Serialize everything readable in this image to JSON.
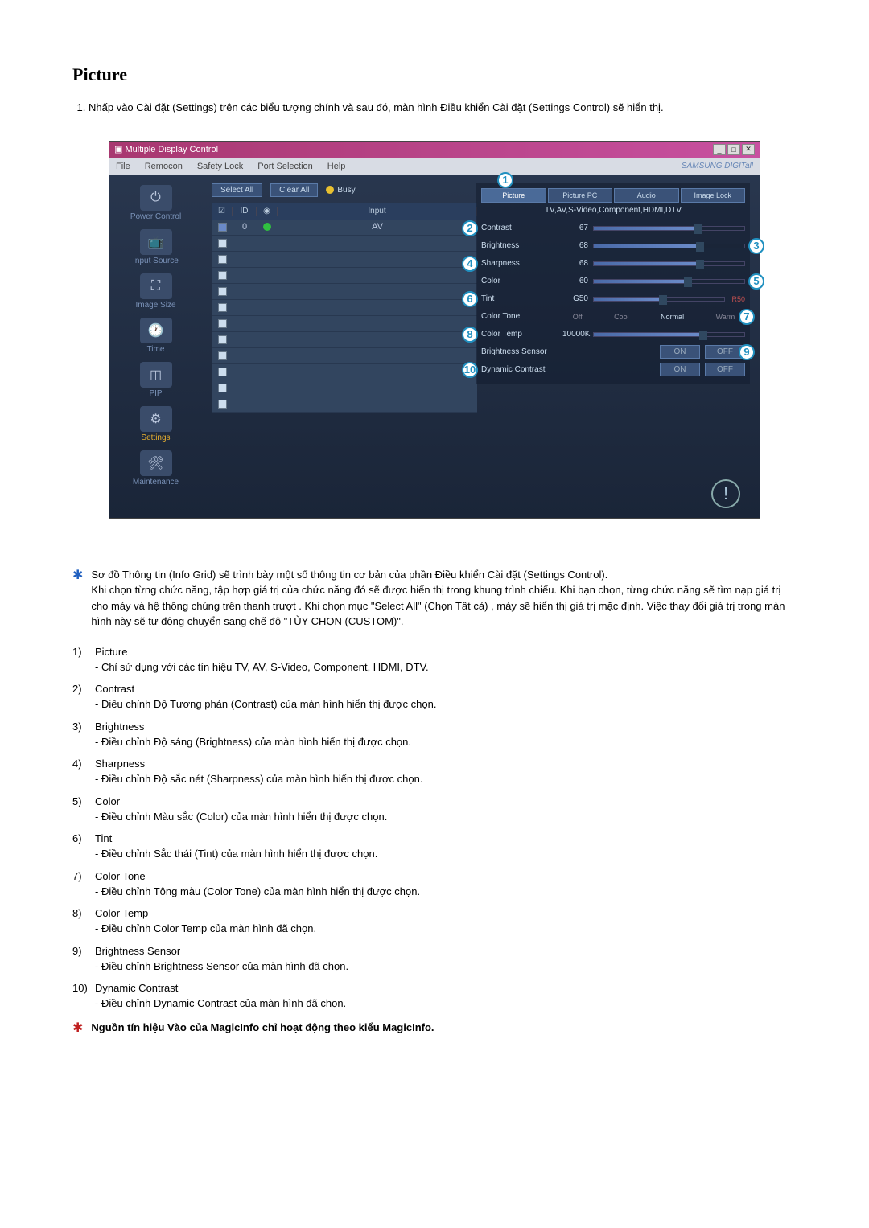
{
  "heading": "Picture",
  "intro_item": "Nhấp vào Cài đặt (Settings) trên các biểu tượng chính và sau đó, màn hình Điều khiển Cài đặt (Settings Control) sẽ hiển thị.",
  "screenshot": {
    "titlebar": "Multiple Display Control",
    "menubar": [
      "File",
      "Remocon",
      "Safety Lock",
      "Port Selection",
      "Help"
    ],
    "brand": "SAMSUNG DIGITall",
    "toolbar": {
      "select_all": "Select All",
      "clear_all": "Clear All",
      "busy": "Busy"
    },
    "sidebar": [
      {
        "label": "Power Control"
      },
      {
        "label": "Input Source"
      },
      {
        "label": "Image Size"
      },
      {
        "label": "Time"
      },
      {
        "label": "PIP"
      },
      {
        "label": "Settings",
        "active": true
      },
      {
        "label": "Maintenance"
      }
    ],
    "grid": {
      "headers": {
        "chk": "",
        "id": "ID",
        "status": "",
        "input": "Input"
      },
      "rows": [
        {
          "checked": true,
          "id": "0",
          "status": "#30c040",
          "input": "AV"
        },
        {
          "checked": false
        },
        {
          "checked": false
        },
        {
          "checked": false
        },
        {
          "checked": false
        },
        {
          "checked": false
        },
        {
          "checked": false
        },
        {
          "checked": false
        },
        {
          "checked": false
        },
        {
          "checked": false
        },
        {
          "checked": false
        },
        {
          "checked": false
        }
      ]
    },
    "panel": {
      "tabs": [
        "Picture",
        "Picture PC",
        "Audio",
        "Image Lock"
      ],
      "active_tab": 0,
      "subtitle": "TV,AV,S-Video,Component,HDMI,DTV",
      "rows": [
        {
          "label": "Contrast",
          "val": "67",
          "pct": 67
        },
        {
          "label": "Brightness",
          "val": "68",
          "pct": 68
        },
        {
          "label": "Sharpness",
          "val": "68",
          "pct": 68
        },
        {
          "label": "Color",
          "val": "60",
          "pct": 60
        },
        {
          "label": "Tint",
          "val": "G50",
          "pct": 50,
          "right": "R50"
        }
      ],
      "colortone": {
        "label": "Color Tone",
        "opts": [
          "Off",
          "Cool",
          "Normal",
          "Warm"
        ]
      },
      "colortemp": {
        "label": "Color Temp",
        "val": "10000K",
        "pct": 70
      },
      "bsensor": {
        "label": "Brightness Sensor",
        "on": "ON",
        "off": "OFF"
      },
      "dyncon": {
        "label": "Dynamic Contrast",
        "on": "ON",
        "off": "OFF"
      }
    }
  },
  "star1": {
    "line1": "Sơ đồ Thông tin (Info Grid) sẽ trình bày một số thông tin cơ bản của phần Điều khiển Cài đặt (Settings Control).",
    "line2": "Khi chọn từng chức năng, tập hợp giá trị của chức năng đó sẽ được hiển thị trong khung trình chiếu. Khi bạn chọn, từng chức năng sẽ tìm nạp giá trị cho máy và hệ thống chúng trên thanh trượt . Khi chọn mục \"Select All\" (Chọn Tất cả) , máy sẽ hiển thị giá trị mặc định. Việc thay đổi giá trị trong màn hình này sẽ tự động chuyển sang chế độ \"TÙY CHỌN (CUSTOM)\"."
  },
  "items": [
    {
      "num": "1)",
      "title": "Picture",
      "desc": "- Chỉ sử dụng với các tín hiệu TV, AV, S-Video, Component, HDMI, DTV."
    },
    {
      "num": "2)",
      "title": "Contrast",
      "desc": "- Điều chỉnh Độ Tương phản (Contrast) của màn hình hiển thị được chọn."
    },
    {
      "num": "3)",
      "title": "Brightness",
      "desc": "- Điều chỉnh Độ sáng (Brightness) của màn hình hiển thị được chọn."
    },
    {
      "num": "4)",
      "title": "Sharpness",
      "desc": "- Điều chỉnh Độ sắc nét (Sharpness) của màn hình hiển thị được chọn."
    },
    {
      "num": "5)",
      "title": "Color",
      "desc": "- Điều chỉnh Màu sắc (Color) của màn hình hiển thị được chọn."
    },
    {
      "num": "6)",
      "title": "Tint",
      "desc": "- Điều chỉnh Sắc thái (Tint) của màn hình hiển thị được chọn."
    },
    {
      "num": "7)",
      "title": "Color Tone",
      "desc": "- Điều chỉnh Tông màu (Color Tone) của màn hình hiển thị được chọn."
    },
    {
      "num": "8)",
      "title": "Color Temp",
      "desc": "- Điều chỉnh Color Temp của màn hình đã chọn."
    },
    {
      "num": "9)",
      "title": "Brightness Sensor",
      "desc": "- Điều chỉnh Brightness Sensor của màn hình đã chọn."
    },
    {
      "num": "10)",
      "title": "Dynamic Contrast",
      "desc": "- Điều chỉnh Dynamic Contrast của màn hình đã chọn."
    }
  ],
  "footnote": "Nguồn tín hiệu Vào của MagicInfo chỉ hoạt động theo kiểu MagicInfo."
}
